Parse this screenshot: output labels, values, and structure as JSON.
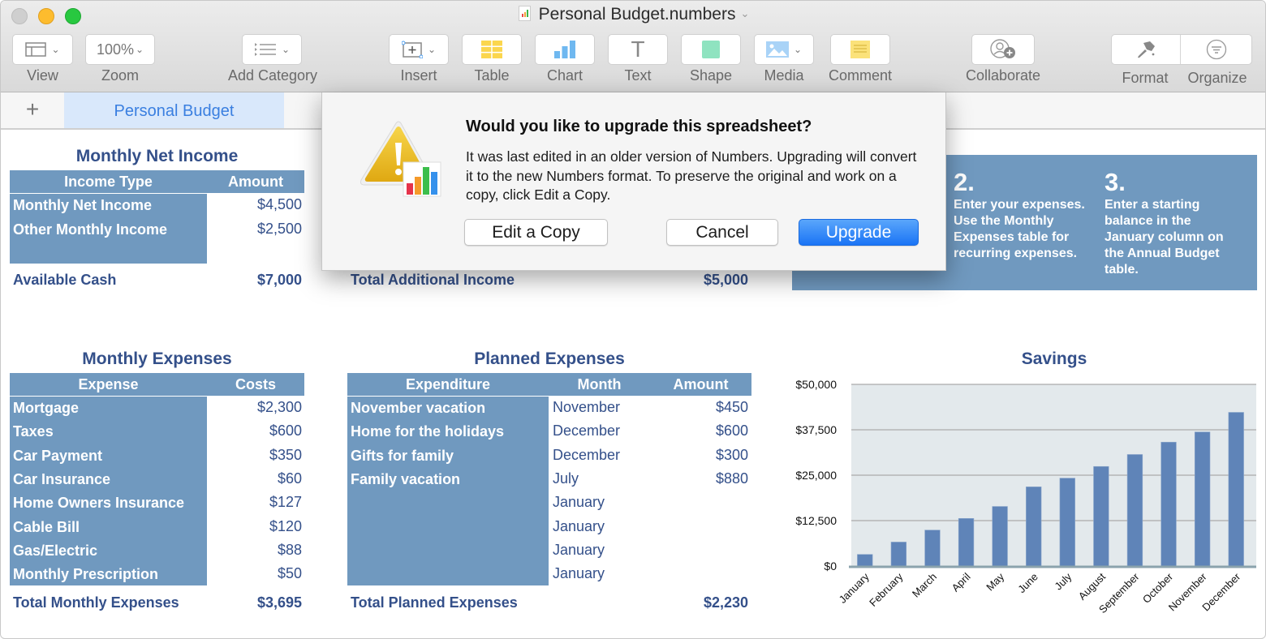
{
  "window": {
    "title": "Personal Budget.numbers"
  },
  "toolbar": {
    "view": {
      "label": "View",
      "icon": "sidebar-layout-icon"
    },
    "zoom": {
      "label": "Zoom",
      "value": "100%"
    },
    "add_category": {
      "label": "Add Category",
      "icon": "list-icon"
    },
    "insert": {
      "label": "Insert",
      "icon": "insert-icon"
    },
    "table": {
      "label": "Table",
      "icon": "table-icon"
    },
    "chart": {
      "label": "Chart",
      "icon": "chart-icon"
    },
    "text": {
      "label": "Text",
      "icon": "text-icon",
      "glyph": "T"
    },
    "shape": {
      "label": "Shape",
      "icon": "shape-icon"
    },
    "media": {
      "label": "Media",
      "icon": "media-icon"
    },
    "comment": {
      "label": "Comment",
      "icon": "comment-icon"
    },
    "collaborate": {
      "label": "Collaborate",
      "icon": "collaborate-icon"
    },
    "format": {
      "label": "Format",
      "icon": "paintbrush-icon"
    },
    "organize": {
      "label": "Organize",
      "icon": "filter-icon"
    }
  },
  "sheets": {
    "add_label": "+",
    "tabs": [
      {
        "label": "Personal Budget",
        "active": true
      }
    ]
  },
  "monthly_net_income": {
    "title": "Monthly Net Income",
    "headers": [
      "Income Type",
      "Amount"
    ],
    "rows": [
      {
        "label": "Monthly Net Income",
        "amount": "$4,500"
      },
      {
        "label": "Other Monthly Income",
        "amount": "$2,500"
      }
    ],
    "total": {
      "label": "Available Cash",
      "amount": "$7,000"
    }
  },
  "additional_income": {
    "total": {
      "label": "Total Additional Income",
      "amount": "$5,000"
    }
  },
  "instructions": [
    {
      "num": "2.",
      "text": "Enter your expenses. Use the Monthly Expenses table for recurring expenses."
    },
    {
      "num": "3.",
      "text": "Enter a starting balance in the January column on the Annual Budget table."
    }
  ],
  "monthly_expenses": {
    "title": "Monthly Expenses",
    "headers": [
      "Expense",
      "Costs"
    ],
    "rows": [
      {
        "label": "Mortgage",
        "amount": "$2,300"
      },
      {
        "label": "Taxes",
        "amount": "$600"
      },
      {
        "label": "Car Payment",
        "amount": "$350"
      },
      {
        "label": "Car Insurance",
        "amount": "$60"
      },
      {
        "label": "Home Owners Insurance",
        "amount": "$127"
      },
      {
        "label": "Cable Bill",
        "amount": "$120"
      },
      {
        "label": "Gas/Electric",
        "amount": "$88"
      },
      {
        "label": "Monthly Prescription",
        "amount": "$50"
      }
    ],
    "total": {
      "label": "Total Monthly Expenses",
      "amount": "$3,695"
    }
  },
  "planned_expenses": {
    "title": "Planned Expenses",
    "headers": [
      "Expenditure",
      "Month",
      "Amount"
    ],
    "rows": [
      {
        "label": "November vacation",
        "month": "November",
        "amount": "$450"
      },
      {
        "label": "Home for the holidays",
        "month": "December",
        "amount": "$600"
      },
      {
        "label": "Gifts for family",
        "month": "December",
        "amount": "$300"
      },
      {
        "label": "Family vacation",
        "month": "July",
        "amount": "$880"
      },
      {
        "label": "",
        "month": "January",
        "amount": ""
      },
      {
        "label": "",
        "month": "January",
        "amount": ""
      },
      {
        "label": "",
        "month": "January",
        "amount": ""
      },
      {
        "label": "",
        "month": "January",
        "amount": ""
      }
    ],
    "total": {
      "label": "Total Planned Expenses",
      "amount": "$2,230"
    }
  },
  "chart_data": {
    "type": "bar",
    "title": "Savings",
    "xlabel": "",
    "ylabel": "",
    "categories": [
      "January",
      "February",
      "March",
      "April",
      "May",
      "June",
      "July",
      "August",
      "September",
      "October",
      "November",
      "December"
    ],
    "values": [
      3200,
      6600,
      9900,
      13100,
      16400,
      21800,
      24200,
      27400,
      30700,
      34100,
      36900,
      42300
    ],
    "ylim": [
      0,
      50000
    ],
    "yticks": [
      0,
      12500,
      25000,
      37500,
      50000
    ],
    "ytick_labels": [
      "$0",
      "$12,500",
      "$25,000",
      "$37,500",
      "$50,000"
    ],
    "grid": true,
    "legend": "none",
    "bar_color": "#5f84b8",
    "plot_bg": "#e3e9ec"
  },
  "dialog": {
    "title": "Would you like to upgrade this spreadsheet?",
    "message": "It was last edited in an older version of Numbers. Upgrading will convert it to the new Numbers format. To preserve the original and work on a copy, click Edit a Copy.",
    "buttons": {
      "edit_copy": "Edit a Copy",
      "cancel": "Cancel",
      "upgrade": "Upgrade"
    },
    "icon": "warning-numbers-icon"
  },
  "colors": {
    "table_header": "#7099bf",
    "text_dark_blue": "#34508a",
    "primary_button": "#1b74f5",
    "sheet_tab_bg": "#d9e8fb"
  }
}
